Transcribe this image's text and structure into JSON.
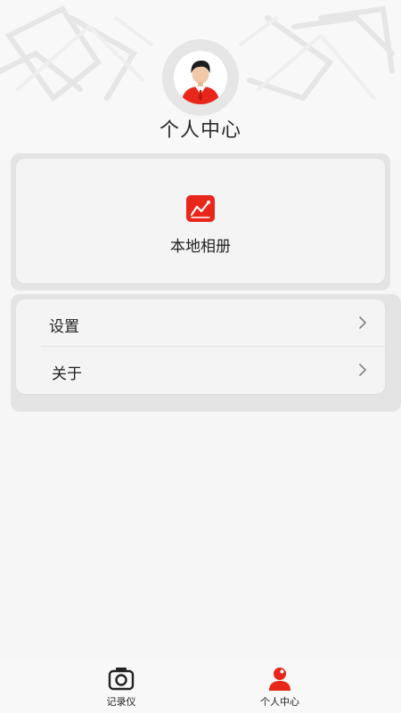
{
  "header": {
    "title": "个人中心"
  },
  "album": {
    "label": "本地相册",
    "icon": "album-chart-icon"
  },
  "menu": {
    "items": [
      {
        "label": "设置",
        "icon": "chevron-right-icon"
      },
      {
        "label": "关于",
        "icon": "chevron-right-icon"
      }
    ]
  },
  "bottom_nav": {
    "items": [
      {
        "label": "记录仪",
        "icon": "camera-icon"
      },
      {
        "label": "个人中心",
        "icon": "person-icon"
      }
    ]
  },
  "colors": {
    "accent": "#e8261a",
    "background": "#f6f6f6",
    "card": "#f4f4f4",
    "text": "#1f1f1f"
  }
}
